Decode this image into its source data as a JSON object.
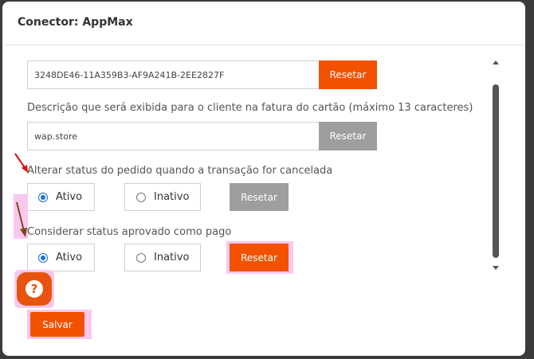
{
  "modal": {
    "title": "Conector: AppMax"
  },
  "token": {
    "value": "3248DE46-11A359B3-AF9A241B-2EE2827F",
    "reset_label": "Resetar"
  },
  "description": {
    "label": "Descrição que será exibida para o cliente na fatura do cartão (máximo 13 caracteres)",
    "value": "wap.store",
    "reset_label": "Resetar"
  },
  "cancel_status": {
    "label": "Alterar status do pedido quando a transação for cancelada",
    "options": [
      {
        "label": "Ativo",
        "checked": true
      },
      {
        "label": "Inativo",
        "checked": false
      }
    ],
    "reset_label": "Resetar"
  },
  "approved_status": {
    "label": "Considerar status aprovado como pago",
    "options": [
      {
        "label": "Ativo",
        "checked": true
      },
      {
        "label": "Inativo",
        "checked": false
      }
    ],
    "reset_label": "Resetar"
  },
  "help": {
    "glyph": "?",
    "icon": "question-icon"
  },
  "footer": {
    "save_label": "Salvar"
  },
  "colors": {
    "accent": "#f25100",
    "disabled": "#9e9e9e",
    "highlight": "#f9c8ef",
    "radio": "#1a6fe0"
  }
}
